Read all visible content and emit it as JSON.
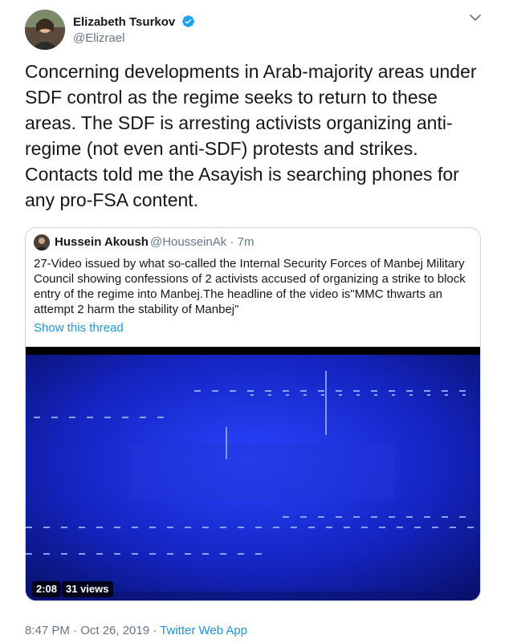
{
  "author": {
    "name": "Elizabeth Tsurkov",
    "handle": "@Elizrael",
    "verified": true
  },
  "tweet": {
    "text": "Concerning developments in Arab-majority areas under SDF control as the regime seeks to return to these areas. The SDF is arresting activists organizing anti-regime (not even anti-SDF) protests and strikes. Contacts told me the Asayish is searching phones for any pro-FSA content."
  },
  "quoted": {
    "name": "Hussein Akoush",
    "handle_time": "@HousseinAk · 7m",
    "text": "27-Video issued by what so-called the Internal Security Forces of Manbej Military Council showing confessions of 2 activists accused of organizing a strike to block entry of the regime into Manbej.The headline of the video is\"MMC thwarts an attempt 2 harm the stability of Manbej\"",
    "show_thread": "Show this thread",
    "video": {
      "duration": "2:08",
      "views": "31 views"
    }
  },
  "footer": {
    "timestamp": "8:47 PM · Oct 26, 2019 · ",
    "source": "Twitter Web App"
  },
  "colors": {
    "link": "#1b95e0",
    "verified": "#1da1f2",
    "video_bg": "#0a1a8c"
  },
  "icons": [
    "verified-badge-icon",
    "chevron-down-icon"
  ]
}
